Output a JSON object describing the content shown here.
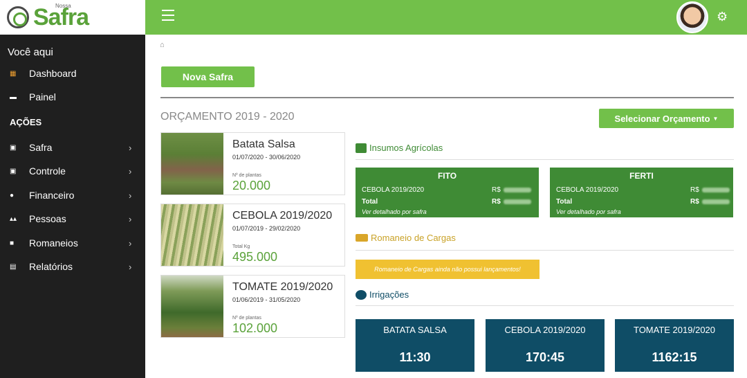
{
  "brand": {
    "small": "Nossa",
    "name": "Safra"
  },
  "sidebar": {
    "heading": "Você aqui",
    "top_items": [
      {
        "label": "Dashboard",
        "icon": "dashboard-icon",
        "icon_color": "#f0a030"
      },
      {
        "label": "Painel",
        "icon": "panel-icon",
        "icon_color": "#ffffff"
      }
    ],
    "section": "AÇÕES",
    "action_items": [
      {
        "label": "Safra",
        "icon": "safra-icon"
      },
      {
        "label": "Controle",
        "icon": "controle-icon"
      },
      {
        "label": "Financeiro",
        "icon": "financeiro-icon"
      },
      {
        "label": "Pessoas",
        "icon": "pessoas-icon"
      },
      {
        "label": "Romaneios",
        "icon": "truck-icon"
      },
      {
        "label": "Relatórios",
        "icon": "relatorios-icon"
      }
    ]
  },
  "main": {
    "nova_safra_label": "Nova Safra",
    "orcamento_title": "ORÇAMENTO 2019 - 2020",
    "select_orcamento_label": "Selecionar Orçamento",
    "crops": [
      {
        "name": "Batata Salsa",
        "dates": "01/07/2020 - 30/06/2020",
        "metric_label": "Nº de plantas",
        "metric_value": "20.000"
      },
      {
        "name": "CEBOLA 2019/2020",
        "dates": "01/07/2019 - 29/02/2020",
        "metric_label": "Total Kg",
        "metric_value": "495.000"
      },
      {
        "name": "TOMATE 2019/2020",
        "dates": "01/06/2019 - 31/05/2020",
        "metric_label": "Nº de plantas",
        "metric_value": "102.000"
      }
    ],
    "insumos": {
      "title": "Insumos Agrícolas",
      "boxes": [
        {
          "title": "FITO",
          "row1_label": "CEBOLA 2019/2020",
          "row2_label": "Total",
          "currency": "R$",
          "note": "Ver detalhado por safra"
        },
        {
          "title": "FERTI",
          "row1_label": "CEBOLA 2019/2020",
          "row2_label": "Total",
          "currency": "R$",
          "note": "Ver detalhado por safra"
        }
      ]
    },
    "romaneio": {
      "title": "Romaneio de Cargas",
      "message": "Romaneio de Cargas ainda não possui lançamentos!"
    },
    "irrigacoes": {
      "title": "Irrigações",
      "boxes": [
        {
          "name": "BATATA SALSA",
          "time": "11:30"
        },
        {
          "name": "CEBOLA 2019/2020",
          "time": "170:45"
        },
        {
          "name": "TOMATE 2019/2020",
          "time": "1162:15"
        }
      ]
    }
  },
  "colors": {
    "green": "#72c04a",
    "dark_green": "#3f8b35",
    "teal": "#0f4d66",
    "yellow": "#f0c131",
    "sidebar": "#1f1f1f",
    "romaneio_title": "#c9a227"
  }
}
